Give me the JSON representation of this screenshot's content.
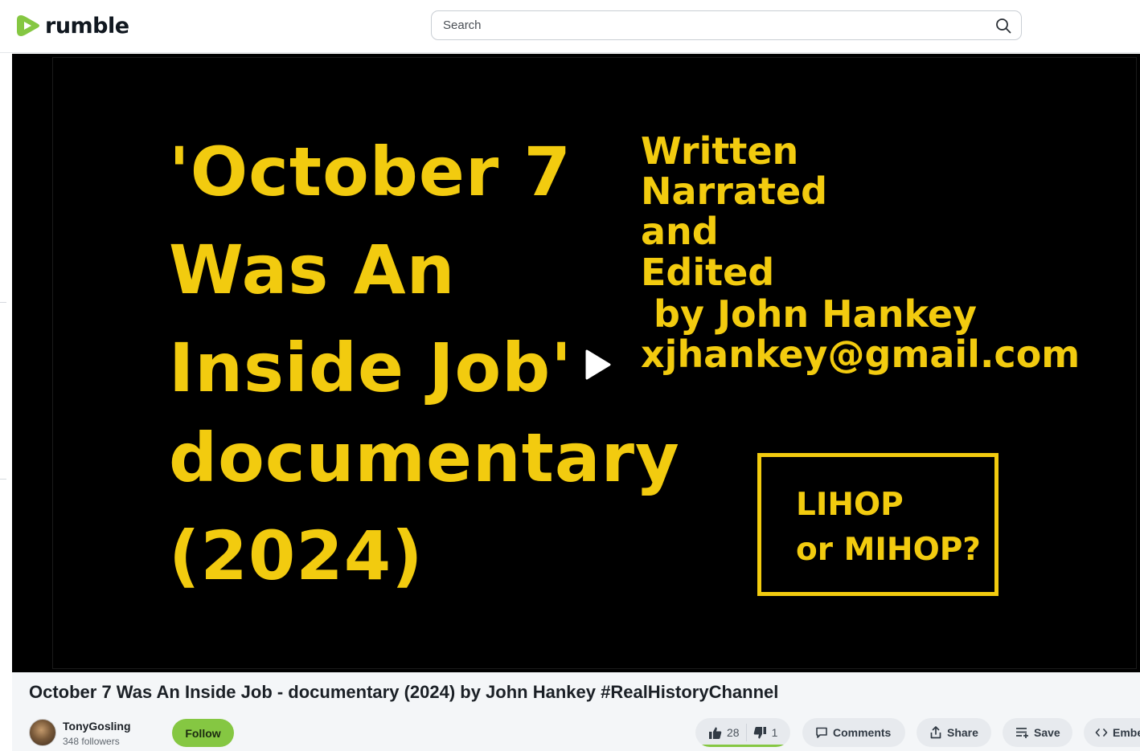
{
  "header": {
    "logo_text": "rumble",
    "search_placeholder": "Search"
  },
  "colors": {
    "brand_green": "#85c742",
    "video_text_yellow": "#f2cb0f"
  },
  "video_frame": {
    "title_lines": [
      "'October 7",
      "Was An",
      "Inside Job'",
      "documentary",
      "(2024)"
    ],
    "credit_lines": [
      "Written",
      "Narrated",
      "and",
      "Edited",
      " by John Hankey",
      "xjhankey@gmail.com"
    ],
    "box_lines": [
      "LIHOP",
      "or MIHOP?"
    ]
  },
  "video": {
    "title": "October 7 Was An Inside Job - documentary (2024) by John Hankey #RealHistoryChannel"
  },
  "channel": {
    "name": "TonyGosling",
    "followers": "348 followers",
    "follow_label": "Follow"
  },
  "actions": {
    "likes": "28",
    "dislikes": "1",
    "comments_label": "Comments",
    "share_label": "Share",
    "save_label": "Save",
    "embed_label": "Embed"
  },
  "icons": [
    "rumble-logo-icon",
    "search-icon",
    "play-icon",
    "thumbs-up-icon",
    "thumbs-down-icon",
    "comment-icon",
    "share-icon",
    "save-playlist-icon",
    "embed-code-icon"
  ]
}
